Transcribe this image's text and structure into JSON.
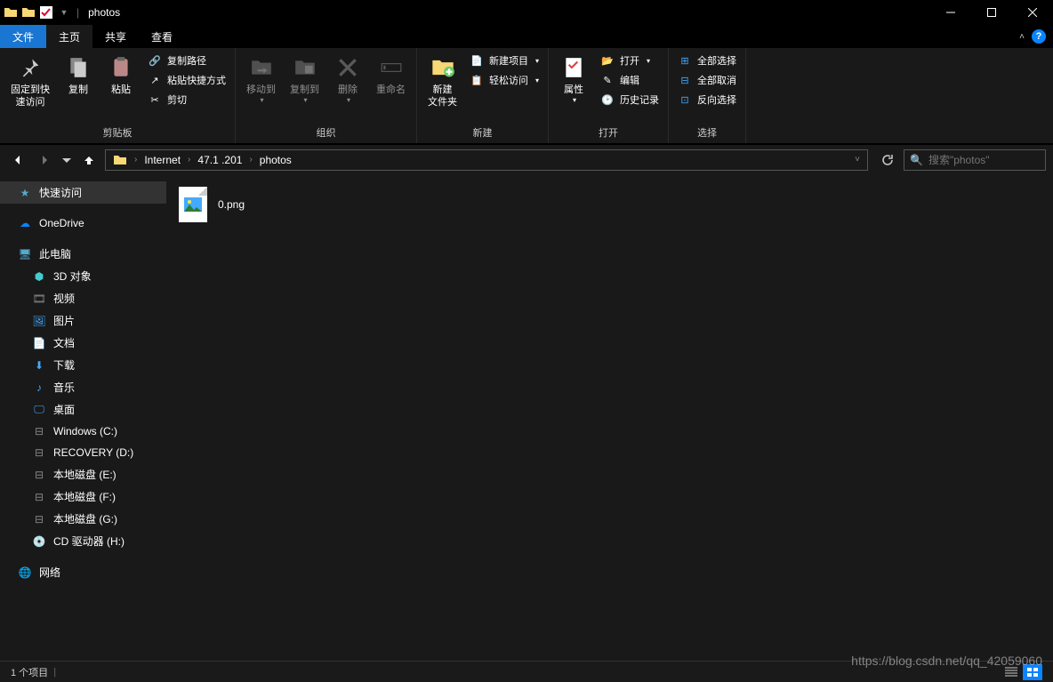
{
  "window": {
    "title": "photos"
  },
  "tabs": {
    "file": "文件",
    "home": "主页",
    "share": "共享",
    "view": "查看"
  },
  "ribbon": {
    "pin": "固定到快\n速访问",
    "copy": "复制",
    "paste": "粘贴",
    "cut": "剪切",
    "copy_path": "复制路径",
    "paste_shortcut": "粘贴快捷方式",
    "clipboard_group": "剪贴板",
    "move_to": "移动到",
    "copy_to": "复制到",
    "delete": "删除",
    "rename": "重命名",
    "organize_group": "组织",
    "new_folder": "新建\n文件夹",
    "new_item": "新建项目",
    "easy_access": "轻松访问",
    "new_group": "新建",
    "properties": "属性",
    "open": "打开",
    "edit": "编辑",
    "history": "历史记录",
    "open_group": "打开",
    "select_all": "全部选择",
    "select_none": "全部取消",
    "invert_selection": "反向选择",
    "select_group": "选择"
  },
  "breadcrumb": {
    "items": [
      "Internet",
      "47.1   .201",
      "photos"
    ]
  },
  "search": {
    "placeholder": "搜索\"photos\""
  },
  "sidebar": {
    "quick_access": "快速访问",
    "onedrive": "OneDrive",
    "this_pc": "此电脑",
    "objects3d": "3D 对象",
    "videos": "视频",
    "pictures": "图片",
    "documents": "文档",
    "downloads": "下载",
    "music": "音乐",
    "desktop": "桌面",
    "drive_c": "Windows (C:)",
    "drive_d": "RECOVERY (D:)",
    "drive_e": "本地磁盘 (E:)",
    "drive_f": "本地磁盘 (F:)",
    "drive_g": "本地磁盘 (G:)",
    "drive_h": "CD 驱动器 (H:)",
    "network": "网络"
  },
  "files": {
    "item0": "0.png"
  },
  "status": {
    "count": "1 个项目"
  },
  "watermark": "https://blog.csdn.net/qq_42059060"
}
